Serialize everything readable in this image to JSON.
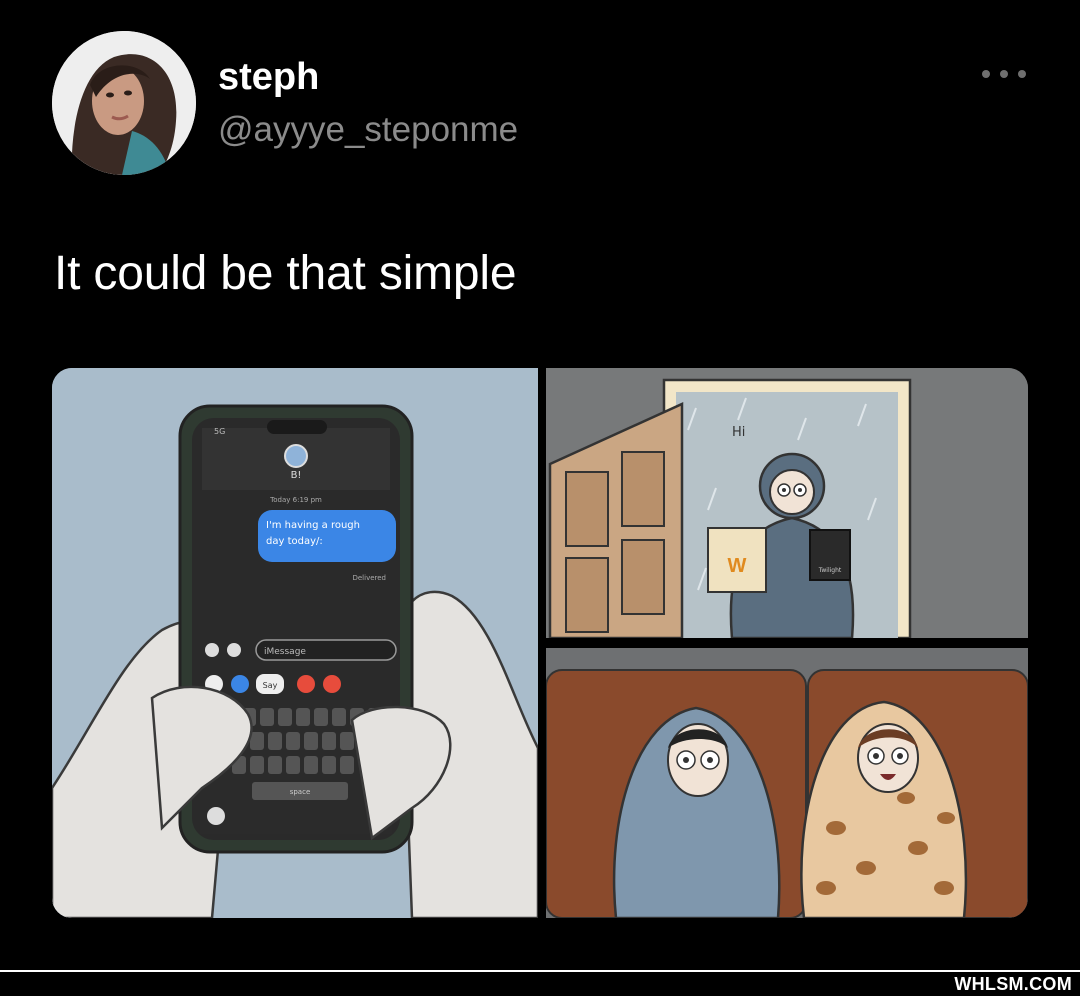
{
  "tweet": {
    "display_name": "steph",
    "handle": "@ayyye_steponme",
    "text": "It could be that simple",
    "more_icon": "more-horizontal-icon"
  },
  "comic": {
    "phone": {
      "carrier": "5G",
      "contact": "B!",
      "timestamp": "Today 6:19 pm",
      "message": [
        "I'm having a rough",
        "day today/:"
      ],
      "status": "Delivered",
      "input_placeholder": "iMessage",
      "spacebar_label": "space",
      "emoji_label": "Say"
    },
    "door_scene": {
      "greeting": "Hi",
      "bag_label": "W",
      "dvd_label": "Twilight"
    }
  },
  "watermark": "WHLSM.COM",
  "colors": {
    "background": "#000000",
    "handle_gray": "#8b8b8b",
    "bubble_blue": "#3b86e6",
    "panel_blue": "#a9bccb"
  }
}
